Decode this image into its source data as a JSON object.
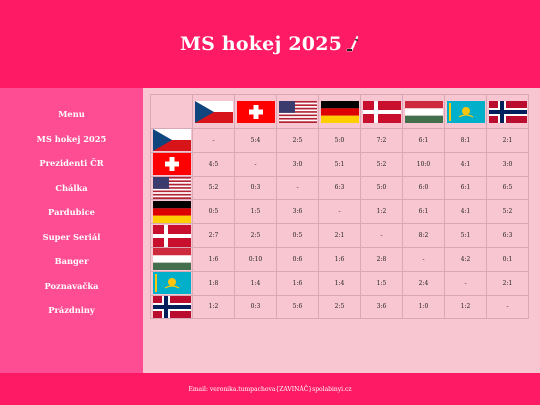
{
  "header": {
    "title": "MS hokej 2025"
  },
  "sidebar": {
    "items": [
      {
        "label": "Menu"
      },
      {
        "label": "MS hokej 2025"
      },
      {
        "label": "Prezidenti ČR"
      },
      {
        "label": "Chálka"
      },
      {
        "label": "Pardubice"
      },
      {
        "label": "Super Seriál"
      },
      {
        "label": "Banger"
      },
      {
        "label": "Poznavačka"
      },
      {
        "label": "Prázdniny"
      }
    ]
  },
  "table": {
    "teams": [
      "czech-flag",
      "swiss-flag",
      "usa-flag",
      "german-flag",
      "danish-flag",
      "hungarian-flag",
      "kazakh-flag",
      "norwegian-flag"
    ],
    "rows": [
      [
        "-",
        "5:4",
        "2:5",
        "5:0",
        "7:2",
        "6:1",
        "8:1",
        "2:1"
      ],
      [
        "4:5",
        "-",
        "3:0",
        "5:1",
        "5:2",
        "10:0",
        "4:1",
        "3:0"
      ],
      [
        "5:2",
        "0:3",
        "-",
        "6:3",
        "5:0",
        "6:0",
        "6:1",
        "6:5"
      ],
      [
        "0:5",
        "1:5",
        "3:6",
        "-",
        "1:2",
        "6:1",
        "4:1",
        "5:2"
      ],
      [
        "2:7",
        "2:5",
        "0:5",
        "2:1",
        "-",
        "8:2",
        "5:1",
        "6:3"
      ],
      [
        "1:6",
        "0:10",
        "0:6",
        "1:6",
        "2:8",
        "-",
        "4:2",
        "0:1"
      ],
      [
        "1:8",
        "1:4",
        "1:6",
        "1:4",
        "1:5",
        "2:4",
        "-",
        "2:1"
      ],
      [
        "1:2",
        "0:3",
        "5:6",
        "2:5",
        "3:6",
        "1:0",
        "1:2",
        "-"
      ]
    ]
  },
  "footer": {
    "email": "Email: veronika.tumpachova{ZAVINÁČ}spolabinyi.cz"
  },
  "colors": {
    "header": "#ff1a66",
    "sidebar": "#ff4d93",
    "main": "#f8c6d0"
  }
}
